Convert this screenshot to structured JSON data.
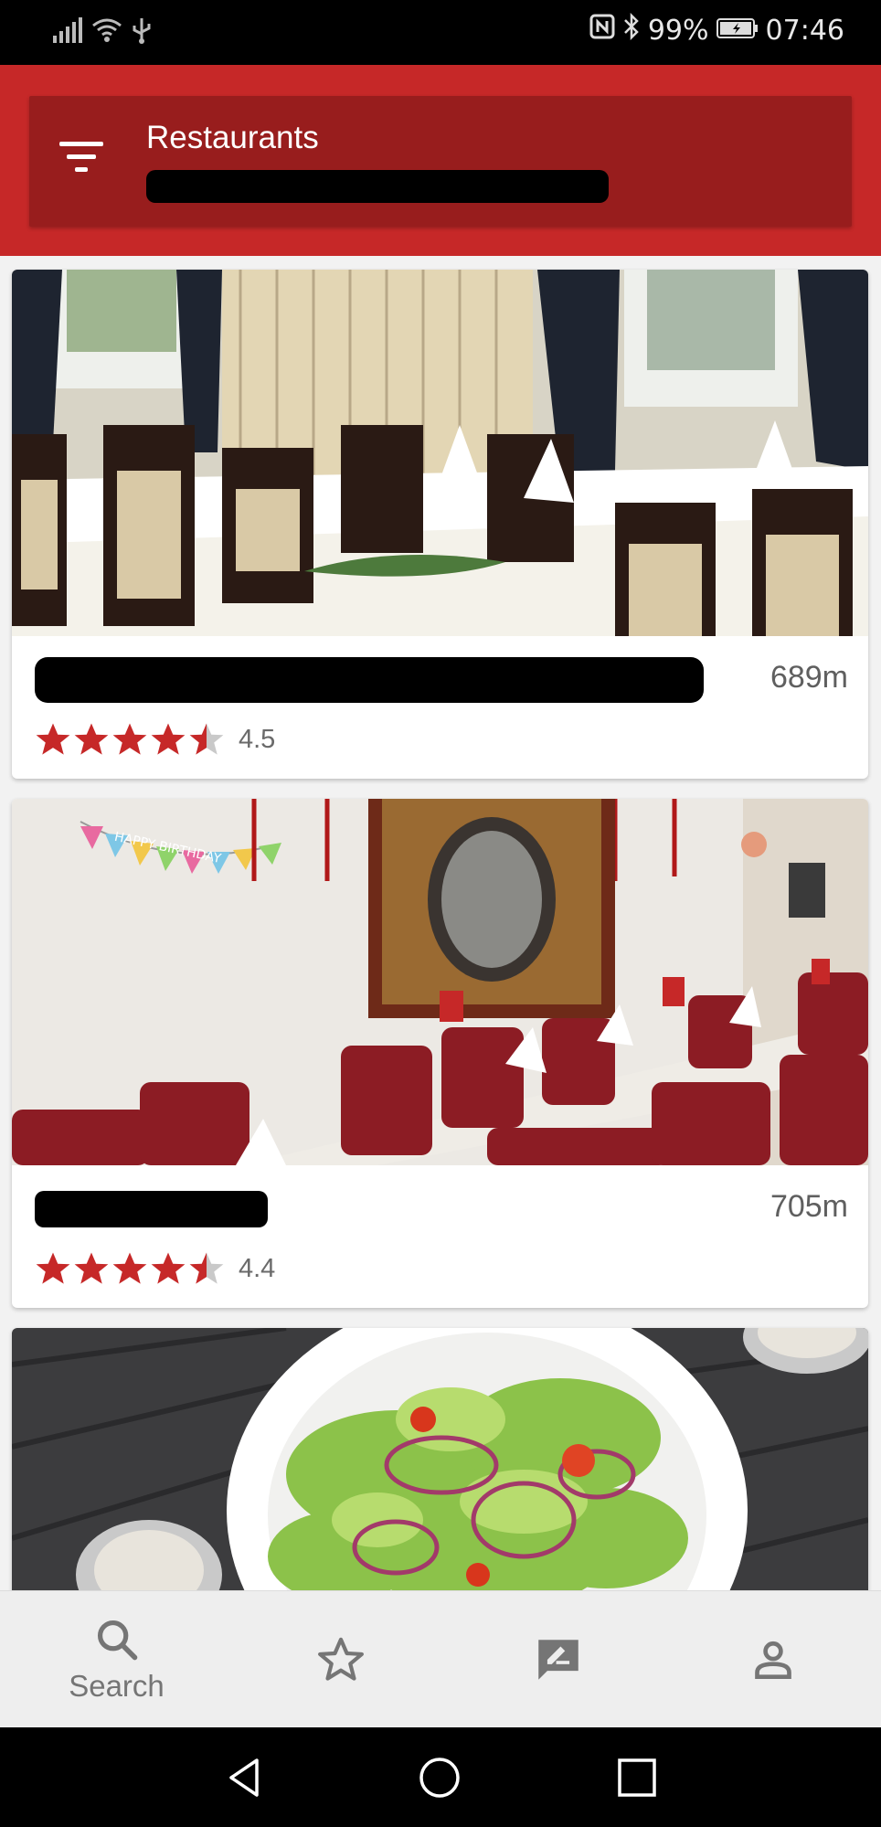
{
  "status_bar": {
    "battery": "99%",
    "time": "07:46",
    "icons": [
      "signal-icon",
      "wifi-icon",
      "usb-icon",
      "nfc-icon",
      "bluetooth-icon",
      "battery-icon"
    ]
  },
  "header": {
    "title": "Restaurants",
    "filter_icon": "filter-icon",
    "background_color": "#c62828",
    "card_color": "#981d1d"
  },
  "restaurants": [
    {
      "distance": "689m",
      "rating_value": "4.5",
      "rating": 4.5,
      "photo": "restaurant dining room with white tablecloths and dark chairs"
    },
    {
      "distance": "705m",
      "rating_value": "4.4",
      "rating": 4.4,
      "photo": "dining room with red chairs, flags and birthday banner"
    },
    {
      "photo": "salad plate on dark wooden table"
    }
  ],
  "photo2": {
    "banner_text": "HAPPY BIRTHDAY"
  },
  "bottom_nav": {
    "items": [
      {
        "label": "Search",
        "icon": "search-icon",
        "active": true
      },
      {
        "label": "",
        "icon": "star-icon"
      },
      {
        "label": "",
        "icon": "rate-review-icon"
      },
      {
        "label": "",
        "icon": "account-icon"
      }
    ]
  },
  "system_nav": {
    "icons": [
      "back-icon",
      "home-icon",
      "recents-icon"
    ]
  },
  "colors": {
    "accent": "#c62828",
    "star": "#c62828",
    "star_empty": "#c9c9c9"
  }
}
